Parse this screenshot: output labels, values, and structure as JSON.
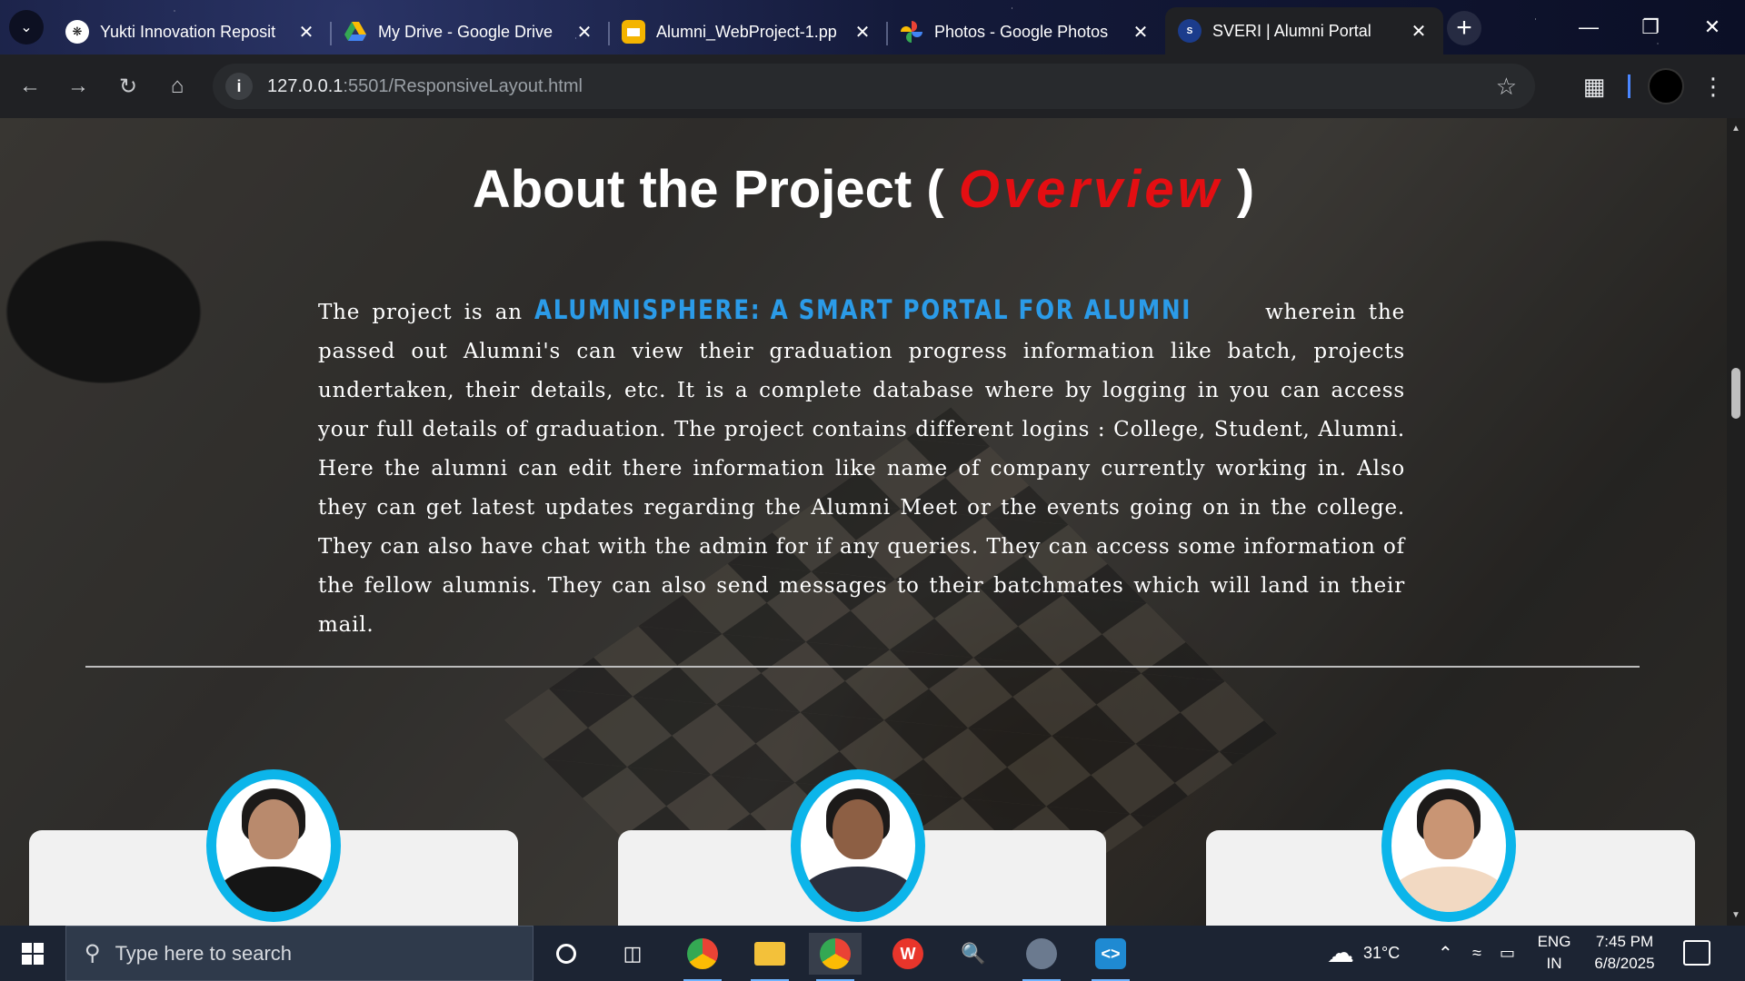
{
  "browser": {
    "tabs": [
      {
        "title": "Yukti Innovation Reposit",
        "favicon": "openai-icon",
        "active": false
      },
      {
        "title": "My Drive - Google Drive",
        "favicon": "google-drive-icon",
        "active": false
      },
      {
        "title": "Alumni_WebProject-1.pp",
        "favicon": "google-slides-icon",
        "active": false
      },
      {
        "title": "Photos - Google Photos",
        "favicon": "google-photos-icon",
        "active": false
      },
      {
        "title": "SVERI | Alumni Portal",
        "favicon": "sveri-logo-icon",
        "active": true
      }
    ],
    "new_tab": "+",
    "url_host": "127.0.0.1",
    "url_rest": ":5501/ResponsiveLayout.html"
  },
  "page": {
    "title_prefix": "About the Project ( ",
    "title_accent": "Overview",
    "title_suffix": " )",
    "intro_start": "The project is an ",
    "highlight": "ALUMNISPHERE: A SMART PORTAL FOR ALUMNI",
    "intro_rest": " wherein the passed out Alumni's can view their graduation progress information like batch, projects undertaken, their details, etc. It is a complete database where by logging in you can access your full details of graduation. The project contains different logins : College, Student, Alumni. Here the alumni can edit there information like name of company currently working in. Also they can get latest updates regarding the Alumni Meet or the events going on in the college. They can also have chat with the admin for if any queries. They can access some information of the fellow alumnis. They can also send messages to their batchmates which will land in their mail.",
    "colors": {
      "accent_red": "#e40e12",
      "highlight_blue": "#2b9be8",
      "avatar_ring": "#0cb5ea"
    }
  },
  "taskbar": {
    "search_placeholder": "Type here to search",
    "weather": "31°C",
    "lang_top": "ENG",
    "lang_bottom": "IN",
    "time": "7:45 PM",
    "date": "6/8/2025",
    "apps": [
      "cortana-icon",
      "task-view-icon",
      "chrome-profile-icon",
      "file-explorer-icon",
      "chrome-icon",
      "wps-office-icon",
      "magnifier-icon",
      "github-desktop-icon",
      "vscode-icon"
    ]
  }
}
